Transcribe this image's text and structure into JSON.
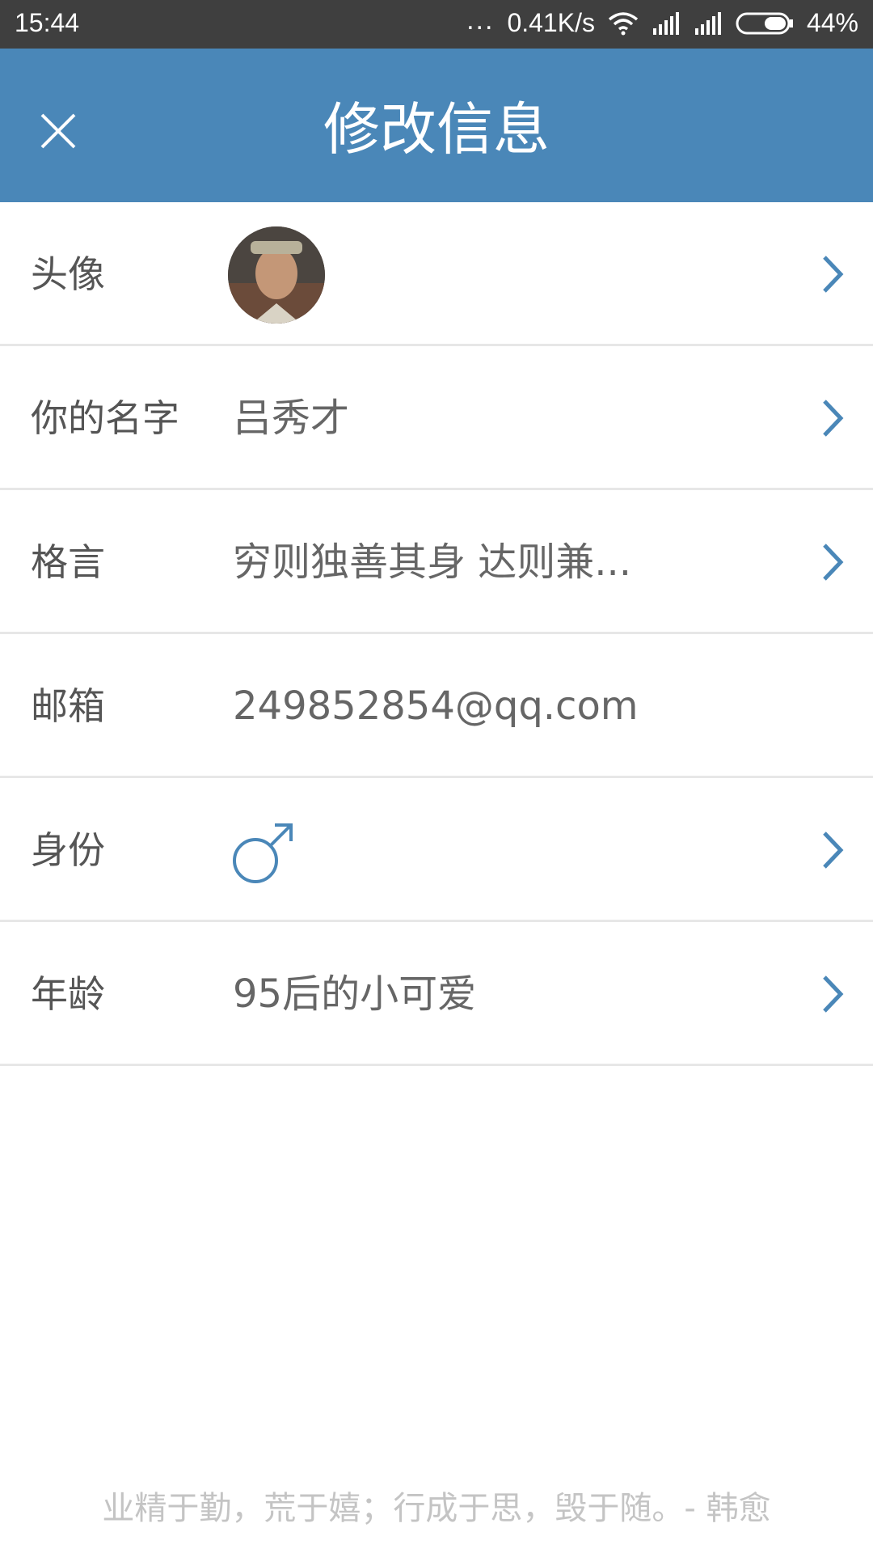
{
  "status_bar": {
    "time": "15:44",
    "dots": "...",
    "network_speed": "0.41K/s",
    "battery": "44%",
    "icons": [
      "wifi-icon",
      "signal-icon",
      "signal-icon",
      "battery-icon"
    ]
  },
  "header": {
    "title": "修改信息",
    "close_icon": "close-icon"
  },
  "colors": {
    "appbar": "#4a87b8",
    "accent": "#4a87b8",
    "statusbar": "#3f3f3f",
    "label_text": "#555555",
    "value_text": "#666666",
    "footer_text": "#c4c4c4"
  },
  "profile": {
    "avatar": {
      "label": "头像",
      "icon": "avatar-image"
    },
    "name": {
      "label": "你的名字",
      "value": "吕秀才"
    },
    "motto": {
      "label": "格言",
      "value": "穷则独善其身 达则兼..."
    },
    "email": {
      "label": "邮箱",
      "value": "249852854@qq.com"
    },
    "gender": {
      "label": "身份",
      "icon": "male-icon"
    },
    "age": {
      "label": "年龄",
      "value": "95后的小可爱"
    }
  },
  "footer": {
    "quote": "业精于勤，荒于嬉；行成于思，毁于随。- 韩愈"
  }
}
